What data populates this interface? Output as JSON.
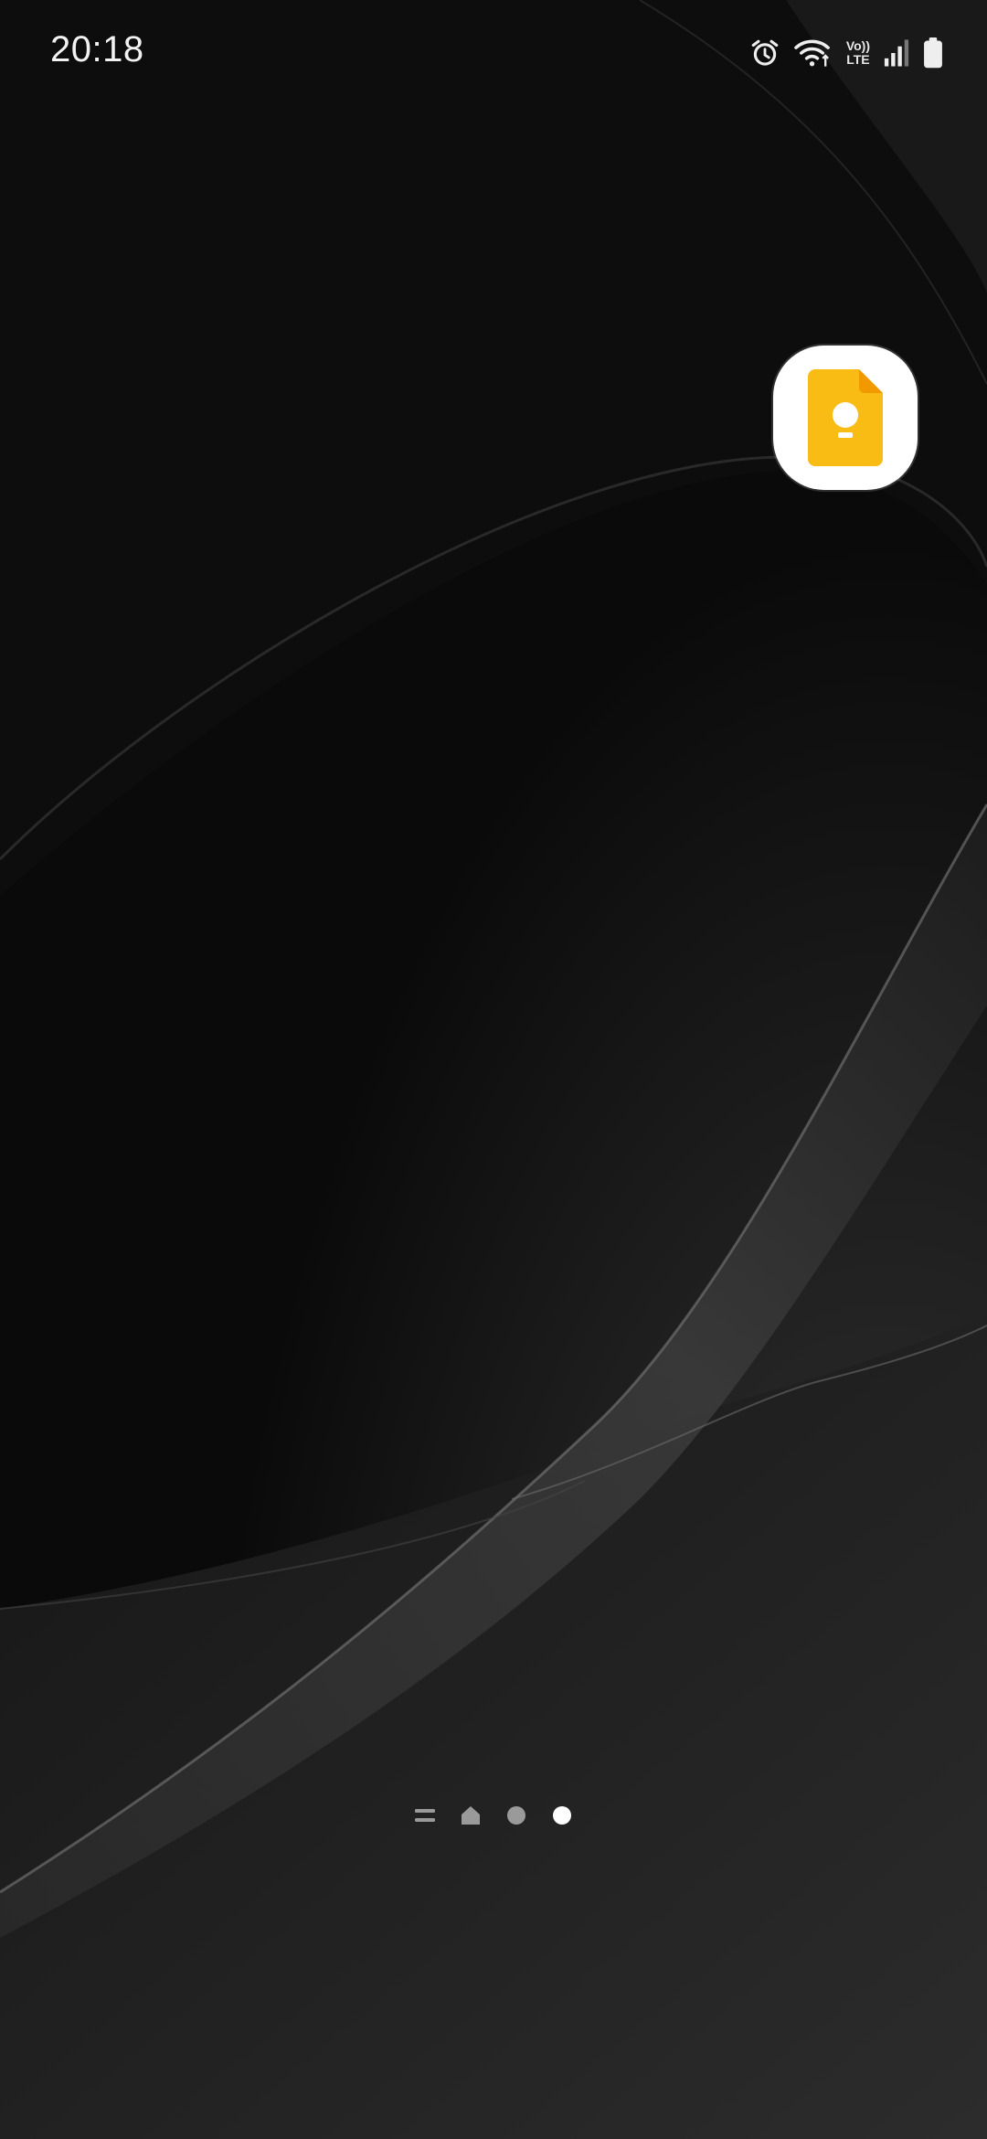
{
  "status_bar": {
    "time": "20:18",
    "icons": [
      "alarm-icon",
      "wifi-icon",
      "volte-icon",
      "signal-icon",
      "battery-icon"
    ],
    "volte_top": "Vo))",
    "volte_bottom": "LTE"
  },
  "home_screen": {
    "apps": [
      {
        "icon": "google-keep-icon",
        "colors": {
          "body": "#F9BC15",
          "fold": "#F29900",
          "bulb": "#FFFFFF"
        }
      }
    ],
    "page_indicator": {
      "items": [
        "menu-page",
        "home-page",
        "page-2",
        "page-3"
      ],
      "active_index": 3
    }
  },
  "colors": {
    "background": "#0a0a0a",
    "indicator_inactive": "#9a9a9a",
    "indicator_active": "#ffffff"
  }
}
